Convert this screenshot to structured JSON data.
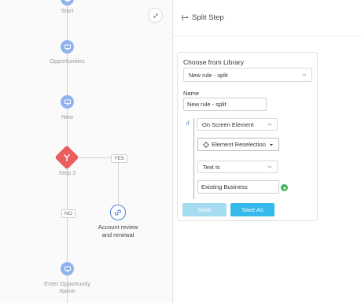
{
  "flow": {
    "nodes": [
      {
        "label": "Start",
        "icon": "monitor-icon"
      },
      {
        "label": "Opportunities",
        "icon": "monitor-icon"
      },
      {
        "label": "New",
        "icon": "monitor-icon"
      },
      {
        "label": "Step 3",
        "icon": "split-icon"
      },
      {
        "label": "Account review\nand renewal",
        "icon": "link-icon"
      },
      {
        "label": "Enter Opportunity\nName",
        "icon": "monitor-icon"
      }
    ],
    "branches": {
      "yes": "YES",
      "no": "NO"
    },
    "colors": {
      "node": "#8fb3ee",
      "split": "#ea5e5e",
      "link": "#4a7fd8"
    }
  },
  "panel": {
    "title": "Split Step",
    "icon": "split-step-icon",
    "library": {
      "title": "Choose from Library",
      "selected": "New rule - split"
    },
    "name_label": "Name",
    "name_value": "New rule - split",
    "condition": {
      "if_label": "if",
      "source": "On Screen Element",
      "reselect_label": "Element Reselection",
      "operator": "Text Is",
      "value": "Existing Business"
    },
    "buttons": {
      "save": "Save",
      "save_as": "Save As"
    },
    "colors": {
      "save": "#a6dcf2",
      "save_as": "#35b8ea",
      "add": "#3db45a"
    }
  }
}
